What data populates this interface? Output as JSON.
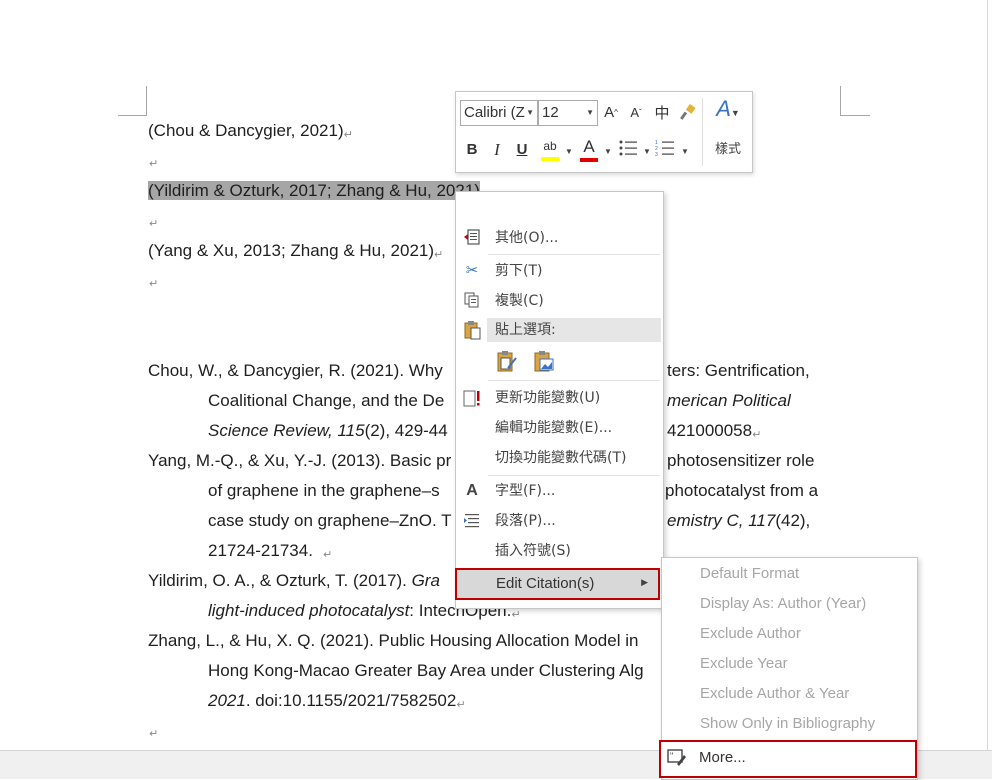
{
  "citations": {
    "line1": "(Chou & Dancygier, 2021)",
    "line2_selected": "(Yildirim & Ozturk, 2017; Zhang & Hu, 2021)",
    "line3": "(Yang & Xu, 2013; Zhang & Hu, 2021)"
  },
  "paragraph_mark": "↵",
  "bibliography": {
    "chou_1": "Chou, W., & Dancygier, R. (2021). Why",
    "chou_1b": "ters: Gentrification,",
    "chou_2": "Coalitional Change, and the De",
    "chou_2b": "merican Political",
    "chou_3": "Science Review, 115",
    "chou_3b": "(2), 429-44",
    "chou_3c": "421000058",
    "yang_1": "Yang, M.-Q., & Xu, Y.-J. (2013). Basic pr",
    "yang_1b": "photosensitizer role",
    "yang_2": "of graphene in the graphene–s",
    "yang_2b": "photocatalyst from a",
    "yang_3": "case study on graphene–ZnO. T",
    "yang_3b": "emistry C, 117",
    "yang_3c": "(42),",
    "yang_4": "21724-21734.",
    "yild_1": "Yildirim, O. A., & Ozturk, T. (2017). ",
    "yild_1i": "Gra",
    "yild_2i": "light-induced photocatalyst",
    "yild_2": ": IntechOpen.",
    "zhang_1": "Zhang, L., & Hu, X. Q. (2021). Public Housing Allocation Model in",
    "zhang_2": "Hong Kong-Macao Greater Bay Area under Clustering Alg",
    "zhang_3i": "2021",
    "zhang_3": ". doi:10.1155/2021/7582502"
  },
  "mini_toolbar": {
    "font_name": "Calibri (Z",
    "font_size": "12",
    "grow_font": "A",
    "shrink_font": "A",
    "phonetic": "中",
    "bold": "B",
    "italic": "I",
    "underline": "U",
    "highlight": "ab",
    "font_color": "A",
    "styles_label": "樣式",
    "highlight_color": "#ffff00",
    "font_color_value": "#e00000"
  },
  "context_menu": {
    "items": [
      {
        "label": "其他(O)...",
        "icon": "clipboard-list-icon"
      },
      {
        "label": "剪下(T)",
        "icon": "scissors-icon"
      },
      {
        "label": "複製(C)",
        "icon": "copy-icon"
      },
      {
        "label": "貼上選項:",
        "icon": "paste-icon"
      },
      {
        "label": "更新功能變數(U)",
        "icon": "update-field-icon"
      },
      {
        "label": "編輯功能變數(E)...",
        "icon": ""
      },
      {
        "label": "切換功能變數代碼(T)",
        "icon": ""
      },
      {
        "label": "字型(F)...",
        "icon": "font-icon"
      },
      {
        "label": "段落(P)...",
        "icon": "paragraph-icon"
      },
      {
        "label": "插入符號(S)",
        "icon": ""
      },
      {
        "label": "Edit Citation(s)",
        "icon": ""
      }
    ]
  },
  "submenu": {
    "items": [
      "Default Format",
      "Display As: Author (Year)",
      "Exclude Author",
      "Exclude Year",
      "Exclude Author & Year",
      "Show Only in Bibliography"
    ],
    "more_label": "More...",
    "disabled_color": "#a6a6a6"
  },
  "accent": {
    "highlight_box": "#c00000",
    "selection": "#a6a6a6"
  }
}
